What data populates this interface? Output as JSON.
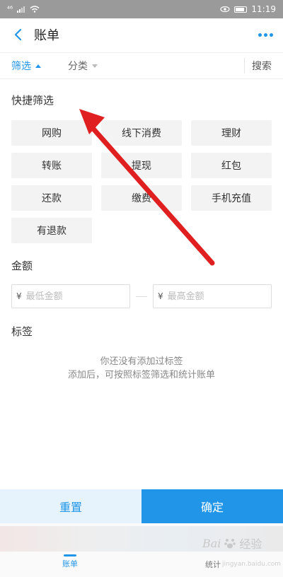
{
  "status_bar": {
    "signal": "⁴⁶",
    "time": "11:19"
  },
  "header": {
    "title": "账单"
  },
  "filter_bar": {
    "tab_filter": "筛选",
    "tab_category": "分类",
    "search": "搜索"
  },
  "quick_filter": {
    "title": "快捷筛选",
    "chips": [
      "网购",
      "线下消费",
      "理财",
      "转账",
      "提现",
      "红包",
      "还款",
      "缴费",
      "手机充值",
      "有退款"
    ]
  },
  "amount": {
    "title": "金额",
    "currency": "¥",
    "min_placeholder": "最低金额",
    "max_placeholder": "最高金额"
  },
  "tags": {
    "title": "标签",
    "empty_line1": "你还没有添加过标签",
    "empty_line2": "添加后，可按照标签筛选和统计账单"
  },
  "actions": {
    "reset": "重置",
    "confirm": "确定"
  },
  "bottom_nav": {
    "bill": "账单",
    "stats": "统计"
  },
  "watermark": {
    "brand": "Bai",
    "brand_cn": "经验",
    "url": "jingyan.baidu.com"
  },
  "colors": {
    "accent": "#2196e8",
    "arrow": "#e02020"
  }
}
